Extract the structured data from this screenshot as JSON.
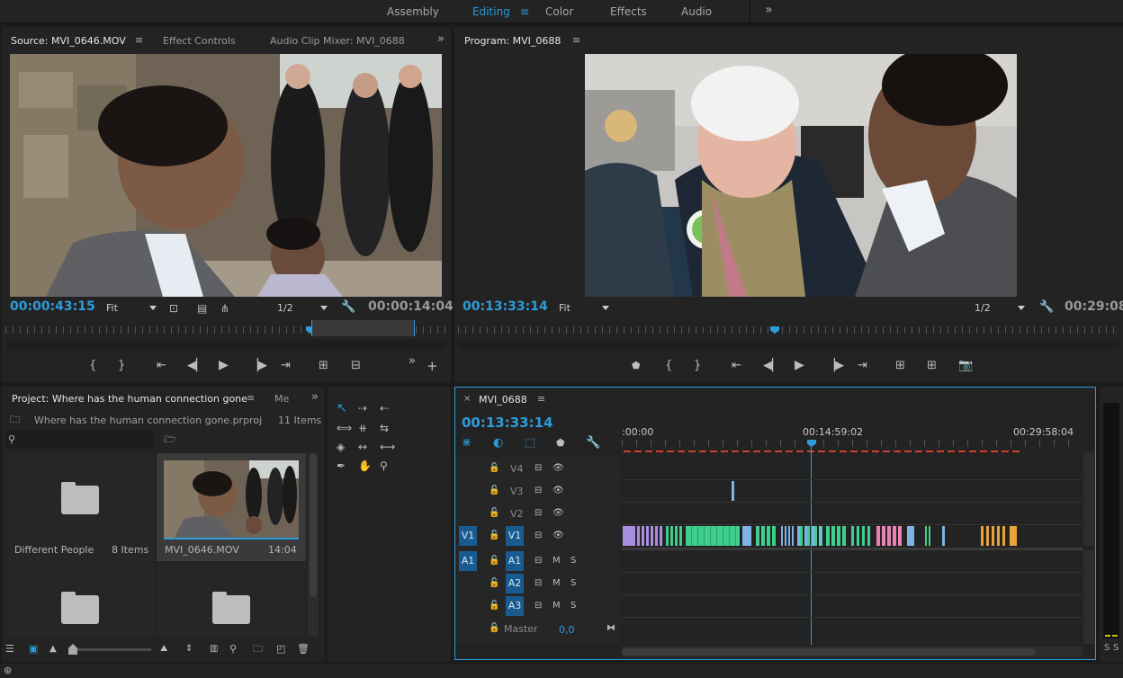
{
  "workspaces": [
    {
      "label": "Assembly"
    },
    {
      "label": "Editing"
    },
    {
      "label": "Color"
    },
    {
      "label": "Effects"
    },
    {
      "label": "Audio"
    }
  ],
  "workspace_more": "»",
  "source": {
    "tabs": [
      "Source: MVI_0646.MOV",
      "Effect Controls",
      "Audio Clip Mixer: MVI_0688"
    ],
    "timecode_in": "00:00:43:15",
    "timecode_dur": "00:00:14:04",
    "zoom": "Fit",
    "resolution": "1/2",
    "more": "»",
    "add": "+"
  },
  "program": {
    "title": "Program: MVI_0688",
    "timecode": "00:13:33:14",
    "timecode_dur": "00:29:08:",
    "zoom": "Fit",
    "resolution": "1/2"
  },
  "project": {
    "title": "Project: Where has the human connection gone",
    "tab2": "Me",
    "file": "Where has the human connection gone.prproj",
    "items_count": "11 Items",
    "bins": [
      {
        "name": "Different People",
        "meta": "8 Items",
        "kind": "folder"
      },
      {
        "name": "MVI_0646.MOV",
        "meta": "14:04",
        "kind": "clip"
      },
      {
        "name": "",
        "meta": "",
        "kind": "folder"
      },
      {
        "name": "",
        "meta": "",
        "kind": "folder"
      }
    ]
  },
  "timeline": {
    "title": "MVI_0688",
    "timecode": "00:13:33:14",
    "ruler_labels": [
      ":00:00",
      "00:14:59:02",
      "00:29:58:04"
    ],
    "tracks": [
      {
        "name": "V4",
        "src": "",
        "type": "video"
      },
      {
        "name": "V3",
        "src": "",
        "type": "video"
      },
      {
        "name": "V2",
        "src": "",
        "type": "video"
      },
      {
        "name": "V1",
        "src": "V1",
        "type": "video"
      },
      {
        "name": "A1",
        "src": "A1",
        "type": "audio"
      },
      {
        "name": "A2",
        "src": "",
        "type": "audio"
      },
      {
        "name": "A3",
        "src": "",
        "type": "audio"
      }
    ],
    "master_label": "Master",
    "master_value": "0,0",
    "mute_label": "M",
    "solo_label": "S"
  },
  "meter_labels": [
    "S",
    "S"
  ],
  "colors": {
    "accent": "#2d9cdb",
    "clip_purple": "#a98ee0",
    "clip_green": "#3ecf8e",
    "clip_pink": "#e882b5",
    "clip_blue": "#7eb3e6",
    "clip_orange": "#e8a33d"
  }
}
